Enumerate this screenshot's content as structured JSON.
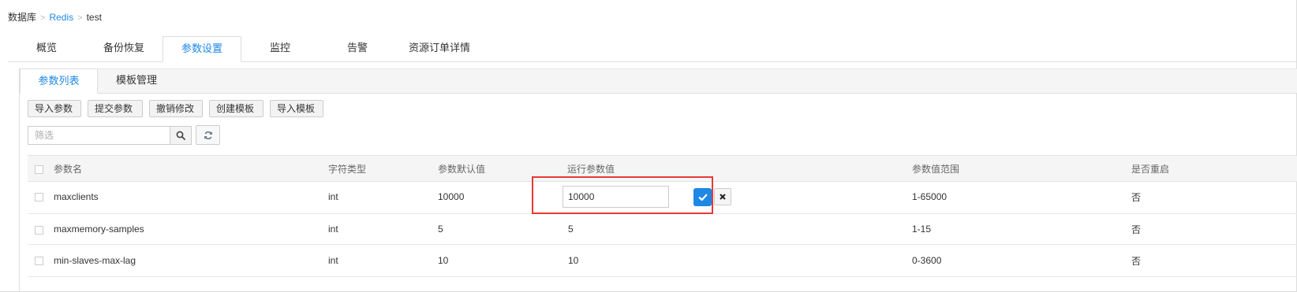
{
  "breadcrumb": {
    "root": "数据库",
    "sep1": ">",
    "engine": "Redis",
    "sep2": ">",
    "instance": "test"
  },
  "main_tabs": [
    {
      "label": "概览"
    },
    {
      "label": "备份恢复"
    },
    {
      "label": "参数设置"
    },
    {
      "label": "监控"
    },
    {
      "label": "告警"
    },
    {
      "label": "资源订单详情"
    }
  ],
  "sub_tabs": [
    {
      "label": "参数列表"
    },
    {
      "label": "模板管理"
    }
  ],
  "toolbar": {
    "import_params": "导入参数",
    "submit_params": "提交参数",
    "undo_changes": "撤销修改",
    "create_template": "创建模板",
    "import_template": "导入模板"
  },
  "search": {
    "placeholder": "筛选",
    "value": ""
  },
  "table": {
    "headers": {
      "name": "参数名",
      "type": "字符类型",
      "default": "参数默认值",
      "running": "运行参数值",
      "range": "参数值范围",
      "restart": "是否重启"
    },
    "rows": [
      {
        "name": "maxclients",
        "type": "int",
        "default": "10000",
        "running": "10000",
        "range": "1-65000",
        "restart": "否"
      },
      {
        "name": "maxmemory-samples",
        "type": "int",
        "default": "5",
        "running": "5",
        "range": "1-15",
        "restart": "否"
      },
      {
        "name": "min-slaves-max-lag",
        "type": "int",
        "default": "10",
        "running": "10",
        "range": "0-3600",
        "restart": "否"
      }
    ]
  },
  "colors": {
    "accent": "#1e88e5",
    "highlight": "#e53935"
  },
  "icons": {
    "search": "search-icon",
    "refresh": "refresh-icon",
    "confirm": "check-icon",
    "cancel": "close-icon"
  }
}
